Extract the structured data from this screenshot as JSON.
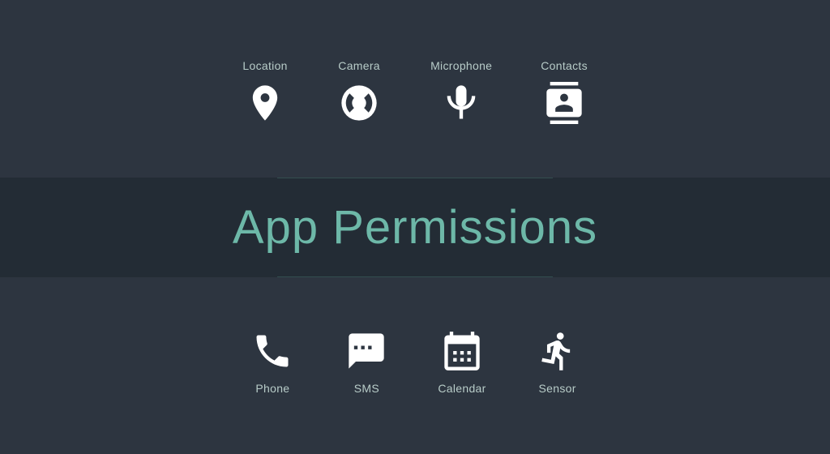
{
  "title": "App Permissions",
  "top_permissions": [
    {
      "id": "location",
      "label": "Location",
      "icon": "location"
    },
    {
      "id": "camera",
      "label": "Camera",
      "icon": "camera"
    },
    {
      "id": "microphone",
      "label": "Microphone",
      "icon": "microphone"
    },
    {
      "id": "contacts",
      "label": "Contacts",
      "icon": "contacts"
    }
  ],
  "bottom_permissions": [
    {
      "id": "phone",
      "label": "Phone",
      "icon": "phone"
    },
    {
      "id": "sms",
      "label": "SMS",
      "icon": "sms"
    },
    {
      "id": "calendar",
      "label": "Calendar",
      "icon": "calendar"
    },
    {
      "id": "sensor",
      "label": "Sensor",
      "icon": "sensor"
    }
  ]
}
